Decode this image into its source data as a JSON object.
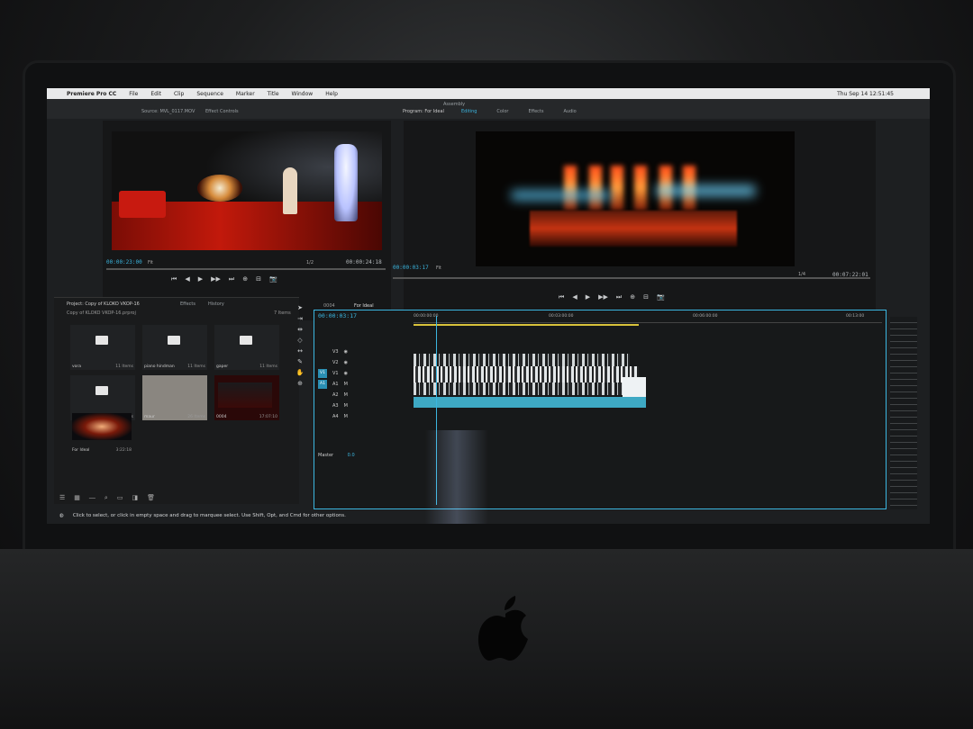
{
  "menubar": {
    "app_name": "Premiere Pro CC",
    "items": [
      "File",
      "Edit",
      "Clip",
      "Sequence",
      "Marker",
      "Title",
      "Window",
      "Help"
    ],
    "clock": "Thu Sep 14  12:51:45"
  },
  "workspace": {
    "title": "Assembly",
    "program_tab": "Program: For Ideal",
    "tabs": [
      "Editing",
      "Color",
      "Effects",
      "Audio"
    ]
  },
  "source_monitor": {
    "tab": "Source: MVL_0117.MOV",
    "tab2": "Effect Controls",
    "timecode_in": "00:00:23:00",
    "fit": "Fit",
    "fraction": "1/2",
    "timecode_duration": "00:00:24:18"
  },
  "program_monitor": {
    "timecode_in": "00:00:03:17",
    "fit": "Fit",
    "fraction": "1/4",
    "timecode_duration": "00:07:22:01"
  },
  "transport_symbols": [
    "⏮",
    "◀",
    "▶",
    "▶▶",
    "⏭",
    "⊕",
    "⊟",
    "📷"
  ],
  "project_panel": {
    "title": "Project: Copy of KLOKO VKOP-16",
    "tabs": [
      "Effects",
      "History"
    ],
    "path": "Copy of KLOKO VKOP-16.prproj",
    "item_count": "7 Items",
    "bins": [
      {
        "label": "vora",
        "count": "11 Items",
        "type": "folder"
      },
      {
        "label": "piano hindman",
        "count": "11 Items",
        "type": "folder"
      },
      {
        "label": "gaper",
        "count": "11 Items",
        "type": "folder"
      },
      {
        "label": "grau",
        "count": "17 Items",
        "type": "folder"
      },
      {
        "label": "maur",
        "count": "26 Items",
        "type": "selected"
      },
      {
        "label": "0004",
        "count": "17:07:10",
        "type": "clip"
      }
    ],
    "sequence": {
      "label": "For Ideal",
      "count": "3:22:18"
    }
  },
  "timeline": {
    "tab_inactive": "0004",
    "tab_active": "For Ideal",
    "timecode": "00:00:03:17",
    "ruler_ticks": [
      "00:00:00:00",
      "00:03:00:00",
      "00:06:00:00",
      "00:13:00"
    ],
    "tracks": [
      {
        "target": "",
        "name": "V3"
      },
      {
        "target": "",
        "name": "V2"
      },
      {
        "target": "V1",
        "name": "V1"
      },
      {
        "target": "A1",
        "name": "A1"
      },
      {
        "target": "",
        "name": "A2"
      },
      {
        "target": "",
        "name": "A3"
      },
      {
        "target": "",
        "name": "A4"
      }
    ],
    "master_label": "Master",
    "master_value": "0.0"
  },
  "status_text": "Click to select, or click in empty space and drag to marquee select. Use Shift, Opt, and Cmd for other options.",
  "colors": {
    "accent": "#3bb6e0",
    "work_area": "#d8c23a",
    "panel_bg": "#1d1f21"
  }
}
